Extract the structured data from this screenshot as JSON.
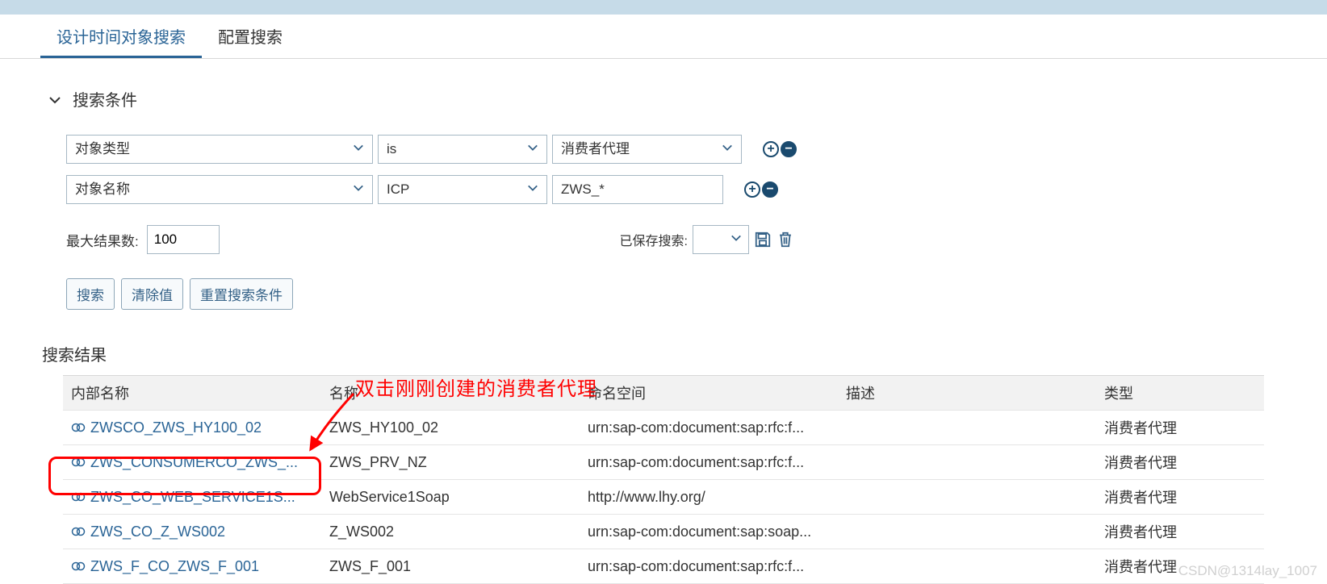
{
  "tabs": {
    "active": "设计时间对象搜索",
    "other": "配置搜索"
  },
  "criteria": {
    "header": "搜索条件",
    "rows": [
      {
        "field": "对象类型",
        "op": "is",
        "value": "消费者代理",
        "value_is_dropdown": true
      },
      {
        "field": "对象名称",
        "op": "ICP",
        "value": "ZWS_*",
        "value_is_dropdown": false
      }
    ],
    "max_label": "最大结果数:",
    "max_value": "100",
    "saved_label": "已保存搜索:"
  },
  "buttons": {
    "search": "搜索",
    "clear": "清除值",
    "reset": "重置搜索条件"
  },
  "results": {
    "title": "搜索结果",
    "headers": {
      "internal": "内部名称",
      "name": "名称",
      "namespace": "命名空间",
      "desc": "描述",
      "type": "类型"
    },
    "rows": [
      {
        "internal": "ZWSCO_ZWS_HY100_02",
        "name": "ZWS_HY100_02",
        "ns": "urn:sap-com:document:sap:rfc:f...",
        "desc": "",
        "type": "消费者代理"
      },
      {
        "internal": "ZWS_CONSUMERCO_ZWS_...",
        "name": "ZWS_PRV_NZ",
        "ns": "urn:sap-com:document:sap:rfc:f...",
        "desc": "",
        "type": "消费者代理"
      },
      {
        "internal": "ZWS_CO_WEB_SERVICE1S...",
        "name": "WebService1Soap",
        "ns": "http://www.lhy.org/",
        "desc": "",
        "type": "消费者代理"
      },
      {
        "internal": "ZWS_CO_Z_WS002",
        "name": "Z_WS002",
        "ns": "urn:sap-com:document:sap:soap...",
        "desc": "",
        "type": "消费者代理"
      },
      {
        "internal": "ZWS_F_CO_ZWS_F_001",
        "name": "ZWS_F_001",
        "ns": "urn:sap-com:document:sap:rfc:f...",
        "desc": "",
        "type": "消费者代理"
      }
    ]
  },
  "annotation": "双击刚刚创建的消费者代理",
  "watermark": "CSDN@1314lay_1007"
}
